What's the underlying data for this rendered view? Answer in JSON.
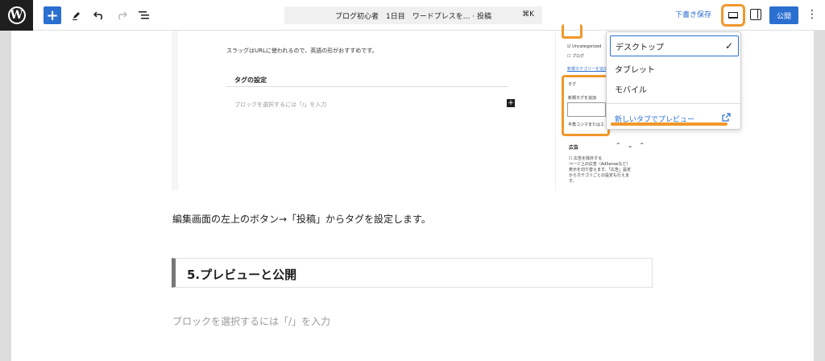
{
  "toolbar": {
    "logo_letter": "W",
    "add_icon": "plus-icon",
    "command_title": "ブログ初心者　1日目　ワードプレスを... · 投稿",
    "command_shortcut": "⌘K",
    "save_draft_label": "下書き保存",
    "publish_label": "公開",
    "more_glyph": "⋮"
  },
  "embedded_shot": {
    "slug_text": "スラッグはURLに使われるので、英語の形がおすすめです。",
    "tag_heading": "タグの設定",
    "block_placeholder": "ブロックを選択するには「/」を入力",
    "sidebar": {
      "category_uncategorized": "Uncategorized",
      "category_blog": "ブログ",
      "new_category_link": "新規カテゴリーを追加",
      "tag_label": "タグ",
      "new_tag_label": "新規タグを追加",
      "tag_hint": "半角コンマまたはエンターキーで区切ります。",
      "ad_heading": "広告",
      "ad_checkbox": "広告を除外する",
      "ad_description": "ページ上の広告（AdSenseなど）表示を切り替えます。「広告」設定からカテゴリごとの設定も行えます。"
    }
  },
  "preview_menu": {
    "items": [
      {
        "label": "デスクトップ",
        "selected": true
      },
      {
        "label": "タブレット",
        "selected": false
      },
      {
        "label": "モバイル",
        "selected": false
      }
    ],
    "check_glyph": "✓",
    "new_tab_label": "新しいタブでプレビュー",
    "external_icon": "external-link-icon"
  },
  "content": {
    "paragraph": "編集画面の左上のボタン→「投稿」からタグを設定します。",
    "heading": "5.プレビューと公開",
    "placeholder": "ブロックを選択するには「/」を入力"
  },
  "colors": {
    "accent": "#2b6fd0",
    "highlight": "#f0982c",
    "logo_bg": "#1e1e1e"
  }
}
